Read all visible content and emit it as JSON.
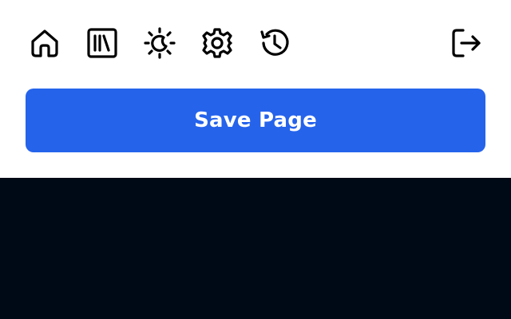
{
  "toolbar": {
    "icons": [
      {
        "name": "home-icon"
      },
      {
        "name": "library-icon"
      },
      {
        "name": "theme-toggle-icon"
      },
      {
        "name": "gear-icon"
      },
      {
        "name": "history-icon"
      },
      {
        "name": "logout-icon"
      }
    ]
  },
  "actions": {
    "save_label": "Save Page"
  },
  "colors": {
    "accent": "#2563eb",
    "popup_background": "#ffffff",
    "page_background": "#000916",
    "icon_stroke": "#000000",
    "button_text": "#ffffff"
  }
}
